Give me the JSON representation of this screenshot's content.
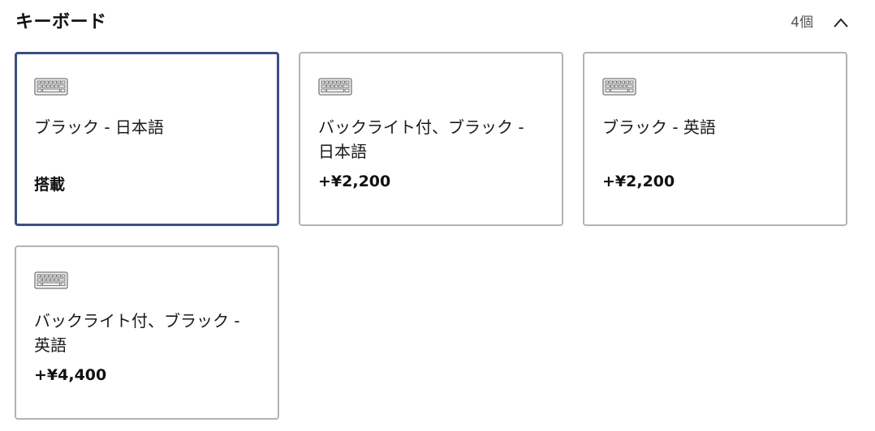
{
  "section": {
    "title": "キーボード",
    "count": "4個",
    "toggle_icon": "chevron-up-icon"
  },
  "options": [
    {
      "name": "ブラック - 日本語",
      "price": "搭載",
      "selected": true,
      "icon": "keyboard-icon"
    },
    {
      "name": "バックライト付、ブラック - 日本語",
      "price": "+¥2,200",
      "selected": false,
      "icon": "keyboard-icon"
    },
    {
      "name": "ブラック - 英語",
      "price": "+¥2,200",
      "selected": false,
      "icon": "keyboard-icon"
    },
    {
      "name": "バックライト付、ブラック - 英語",
      "price": "+¥4,400",
      "selected": false,
      "icon": "keyboard-icon"
    }
  ],
  "colors": {
    "selected_border": "#3b4e85",
    "card_border": "#b3b3b3"
  }
}
